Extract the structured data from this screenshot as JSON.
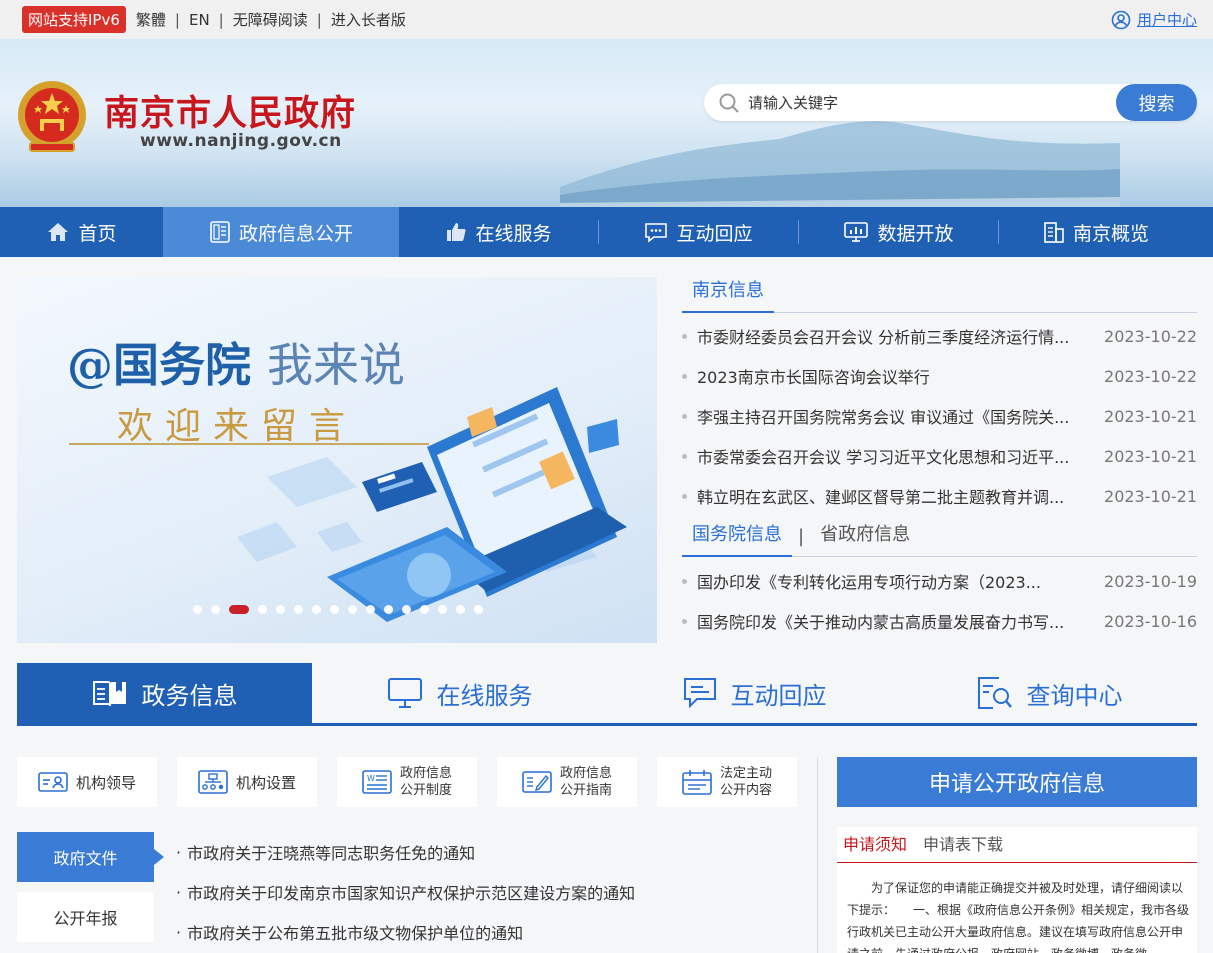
{
  "topbar": {
    "ipv6": "网站支持IPv6",
    "links": [
      "繁體",
      "EN",
      "无障碍阅读",
      "进入长者版"
    ],
    "user_center": "用户中心"
  },
  "header": {
    "title": "南京市人民政府",
    "url": "www.nanjing.gov.cn",
    "search_placeholder": "请输入关键字",
    "search_button": "搜索"
  },
  "nav": [
    {
      "label": "首页",
      "icon": "home-icon"
    },
    {
      "label": "政府信息公开",
      "icon": "document-icon"
    },
    {
      "label": "在线服务",
      "icon": "thumbs-up-icon"
    },
    {
      "label": "互动回应",
      "icon": "chat-icon"
    },
    {
      "label": "数据开放",
      "icon": "monitor-chart-icon"
    },
    {
      "label": "南京概览",
      "icon": "building-icon"
    }
  ],
  "banner": {
    "line1_bold": "@国务院",
    "line1_light": "我来说",
    "line2": "欢迎来留言",
    "slide_count": 16,
    "active_slide": 2
  },
  "news_a": {
    "tab": "南京信息",
    "items": [
      {
        "title": "市委财经委员会召开会议 分析前三季度经济运行情...",
        "date": "2023-10-22"
      },
      {
        "title": "2023南京市长国际咨询会议举行",
        "date": "2023-10-22"
      },
      {
        "title": "李强主持召开国务院常务会议 审议通过《国务院关...",
        "date": "2023-10-21"
      },
      {
        "title": "市委常委会召开会议 学习习近平文化思想和习近平...",
        "date": "2023-10-21"
      },
      {
        "title": "韩立明在玄武区、建邺区督导第二批主题教育并调...",
        "date": "2023-10-21"
      }
    ]
  },
  "news_b": {
    "tab_active": "国务院信息",
    "tab_sep": "|",
    "tab_other": "省政府信息",
    "items": [
      {
        "title": "国办印发《专利转化运用专项行动方案（2023...",
        "date": "2023-10-19"
      },
      {
        "title": "国务院印发《关于推动内蒙古高质量发展奋力书写...",
        "date": "2023-10-16"
      }
    ]
  },
  "bigtabs": [
    {
      "label": "政务信息",
      "icon": "book-icon"
    },
    {
      "label": "在线服务",
      "icon": "monitor-icon"
    },
    {
      "label": "互动回应",
      "icon": "chat-icon"
    },
    {
      "label": "查询中心",
      "icon": "search-document-icon"
    }
  ],
  "quick": [
    {
      "label": "机构领导",
      "icon": "id-card-icon"
    },
    {
      "label": "机构设置",
      "icon": "org-chart-icon"
    },
    {
      "label1": "政府信息",
      "label2": "公开制度",
      "icon": "word-doc-icon"
    },
    {
      "label1": "政府信息",
      "label2": "公开指南",
      "icon": "edit-doc-icon"
    },
    {
      "label1": "法定主动",
      "label2": "公开内容",
      "icon": "calendar-icon"
    }
  ],
  "sidetabs": [
    "政府文件",
    "公开年报"
  ],
  "docs": [
    "市政府关于汪晓燕等同志职务任免的通知",
    "市政府关于印发南京市国家知识产权保护示范区建设方案的通知",
    "市政府关于公布第五批市级文物保护单位的通知"
  ],
  "apply": {
    "title": "申请公开政府信息",
    "tab_active": "申请须知",
    "tab_other": "申请表下载",
    "text": "为了保证您的申请能正确提交并被及时处理，请仔细阅读以下提示：　　一、根据《政府信息公开条例》相关规定，我市各级行政机关已主动公开大量政府信息。建议在填写政府信息公开申请之前，先通过政府公报、政府网站、政务微博、政务微"
  },
  "colors": {
    "brand_red": "#c8161d",
    "nav_blue": "#1f5fb4",
    "accent_blue": "#3a7bd5"
  }
}
